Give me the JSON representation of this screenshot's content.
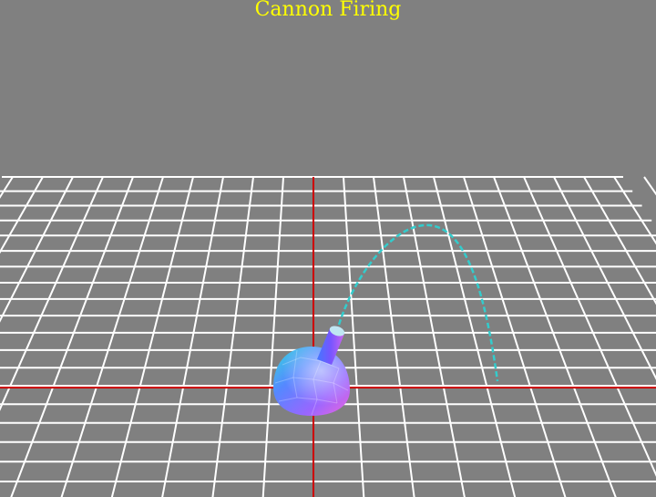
{
  "window": {
    "title": "Cannon Firing"
  },
  "scene": {
    "background_color": "#808080",
    "grid_color": "#ffffff",
    "axis_color": "#cc0000",
    "trajectory_color": "#33cccc",
    "title_color": "#ffff00",
    "objects": [
      "ground-grid",
      "x-axis",
      "z-axis",
      "cannon-base",
      "cannon-barrel",
      "projectile-trajectory"
    ]
  }
}
